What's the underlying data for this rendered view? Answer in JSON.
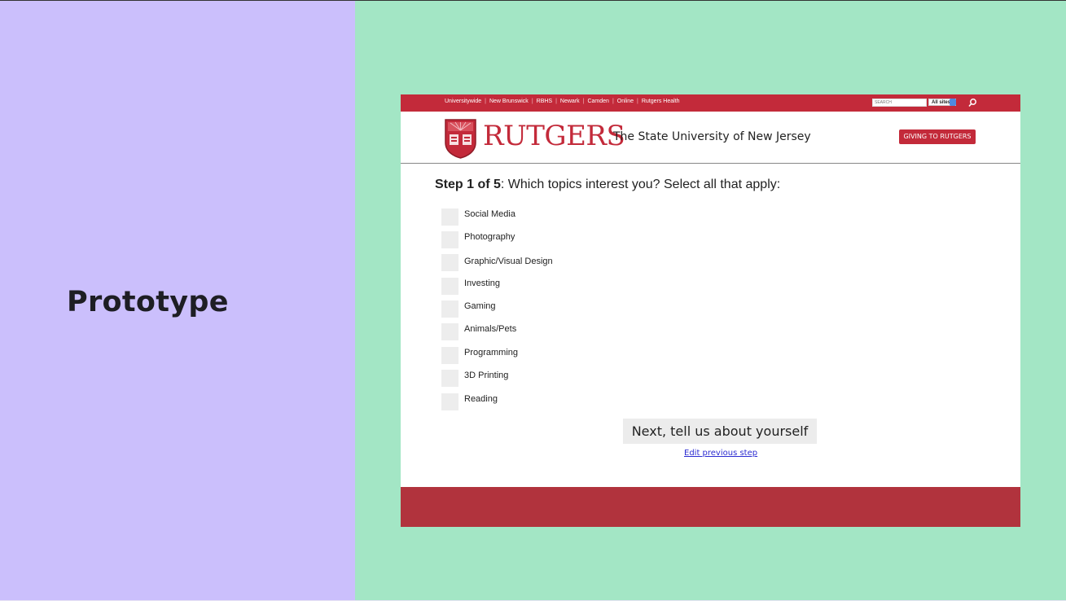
{
  "slide": {
    "title": "Prototype",
    "colors": {
      "left_bg": "#cbbffc",
      "right_bg": "#a3e6c5"
    }
  },
  "site": {
    "colors": {
      "brand_red": "#c32a3a",
      "footer_red": "#b1333d"
    },
    "topnav": [
      "Universitywide",
      "New Brunswick",
      "RBHS",
      "Newark",
      "Camden",
      "Online",
      "Rutgers Health"
    ],
    "search": {
      "placeholder": "SEARCH",
      "scope_selected": "All sites",
      "icon": "search-icon"
    },
    "header": {
      "logo_icon": "rutgers-shield-icon",
      "wordmark": "RUTGERS",
      "tagline": "The State University of New Jersey",
      "giving_button": "GIVING TO RUTGERS"
    },
    "form": {
      "step_label": "Step 1 of 5",
      "question": ": Which topics interest you? Select all that apply:",
      "topics": [
        {
          "label": "Social Media",
          "checked": false
        },
        {
          "label": "Photography",
          "checked": false
        },
        {
          "label": "Graphic/Visual Design",
          "checked": false
        },
        {
          "label": "Investing",
          "checked": false
        },
        {
          "label": "Gaming",
          "checked": false
        },
        {
          "label": "Animals/Pets",
          "checked": false
        },
        {
          "label": "Programming",
          "checked": false
        },
        {
          "label": "3D Printing",
          "checked": false
        },
        {
          "label": "Reading",
          "checked": false
        }
      ],
      "next_button": "Next, tell us about yourself",
      "edit_link": "Edit previous step"
    }
  }
}
